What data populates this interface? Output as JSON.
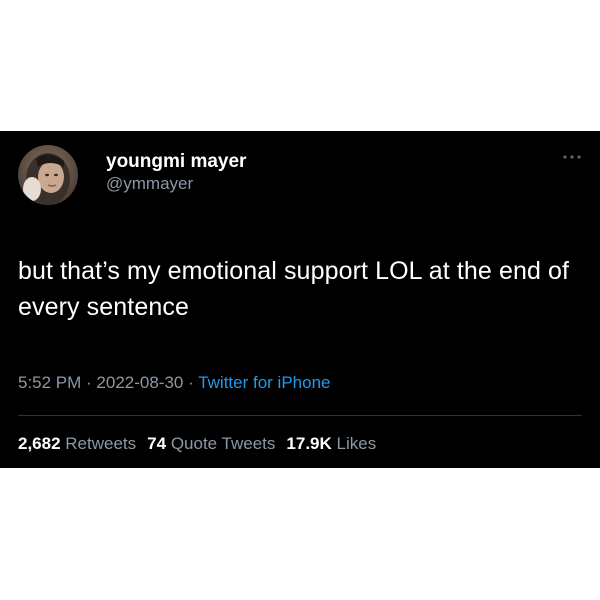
{
  "author": {
    "display_name": "youngmi mayer",
    "handle": "@ymmayer",
    "avatar_icon": "profile-photo"
  },
  "tweet": {
    "text": "but that’s my emotional support LOL at the end of every sentence"
  },
  "meta": {
    "time": "5:52 PM",
    "separator": " · ",
    "date": "2022-08-30",
    "source": "Twitter for iPhone"
  },
  "stats": {
    "retweets_count": "2,682",
    "retweets_label": "Retweets",
    "quotes_count": "74",
    "quotes_label": "Quote Tweets",
    "likes_count": "17.9K",
    "likes_label": "Likes"
  },
  "colors": {
    "background": "#000000",
    "primary_text": "#ffffff",
    "secondary_text": "#8b98a5",
    "link": "#1d9bf0"
  }
}
